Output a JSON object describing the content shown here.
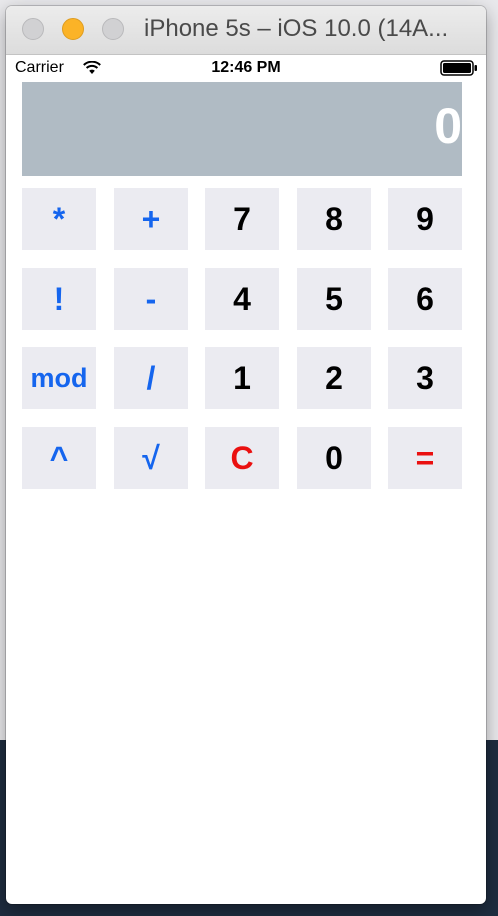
{
  "window": {
    "title": "iPhone 5s – iOS 10.0 (14A..."
  },
  "status_bar": {
    "carrier": "Carrier",
    "time": "12:46 PM",
    "battery_level": 1.0
  },
  "display": {
    "value": "0"
  },
  "keypad": {
    "rows": [
      [
        {
          "label": "*",
          "kind": "operator"
        },
        {
          "label": "+",
          "kind": "operator"
        },
        {
          "label": "7",
          "kind": "digit"
        },
        {
          "label": "8",
          "kind": "digit"
        },
        {
          "label": "9",
          "kind": "digit"
        }
      ],
      [
        {
          "label": "!",
          "kind": "operator"
        },
        {
          "label": "-",
          "kind": "operator"
        },
        {
          "label": "4",
          "kind": "digit"
        },
        {
          "label": "5",
          "kind": "digit"
        },
        {
          "label": "6",
          "kind": "digit"
        }
      ],
      [
        {
          "label": "mod",
          "kind": "operator"
        },
        {
          "label": "/",
          "kind": "operator"
        },
        {
          "label": "1",
          "kind": "digit"
        },
        {
          "label": "2",
          "kind": "digit"
        },
        {
          "label": "3",
          "kind": "digit"
        }
      ],
      [
        {
          "label": "^",
          "kind": "operator"
        },
        {
          "label": "√",
          "kind": "operator"
        },
        {
          "label": "C",
          "kind": "clear"
        },
        {
          "label": "0",
          "kind": "digit"
        },
        {
          "label": "=",
          "kind": "equals"
        }
      ]
    ]
  },
  "colors": {
    "operator": "#1565ee",
    "digit": "#000000",
    "clear": "#ea1010",
    "equals": "#ea1010",
    "key_background": "#ebebf1",
    "display_background": "#b0bbc4"
  },
  "icons": {
    "window_controls": [
      "close-icon",
      "minimize-icon",
      "zoom-icon"
    ],
    "status": [
      "wifi-icon",
      "battery-icon"
    ]
  }
}
